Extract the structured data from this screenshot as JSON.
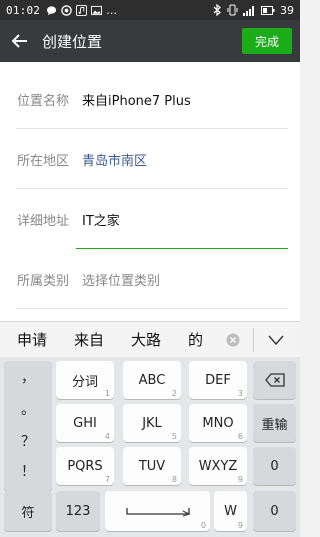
{
  "status_bar": {
    "time": "01:02",
    "battery": "39"
  },
  "nav": {
    "title": "创建位置",
    "done": "完成"
  },
  "form": {
    "rows": [
      {
        "label": "位置名称",
        "value": "来自iPhone7 Plus"
      },
      {
        "label": "所在地区",
        "value": "青岛市南区"
      },
      {
        "label": "详细地址",
        "value": "IT之家"
      },
      {
        "label": "所属类别",
        "value": "选择位置类别"
      }
    ]
  },
  "suggestions": [
    "申请",
    "来自",
    "大路",
    "的"
  ],
  "keyboard": {
    "punct": [
      "，",
      "。",
      "？",
      "！"
    ],
    "rows": [
      [
        {
          "label": "分词",
          "num": "1"
        },
        {
          "label": "ABC",
          "num": "2"
        },
        {
          "label": "DEF",
          "num": "3"
        }
      ],
      [
        {
          "label": "GHI",
          "num": "4"
        },
        {
          "label": "JKL",
          "num": "5"
        },
        {
          "label": "MNO",
          "num": "6"
        }
      ],
      [
        {
          "label": "PQRS",
          "num": "7"
        },
        {
          "label": "TUV",
          "num": "8"
        },
        {
          "label": "WXYZ",
          "num": "9"
        }
      ]
    ],
    "side": {
      "reinput": "重输",
      "zero": "0"
    },
    "bottom": {
      "symbol": "符",
      "num123": "123",
      "space_num": "0",
      "w_label": "W",
      "w_num": "9",
      "zero": "0"
    }
  },
  "icons": {
    "back": "back-arrow-icon",
    "clear": "clear-circle-icon",
    "collapse": "collapse-keyboard-icon",
    "backspace": "backspace-icon",
    "space": "space-bar-icon"
  },
  "colors": {
    "nav_bg": "#393a3e",
    "accent": "#1aad19",
    "link": "#3d5a8a"
  }
}
